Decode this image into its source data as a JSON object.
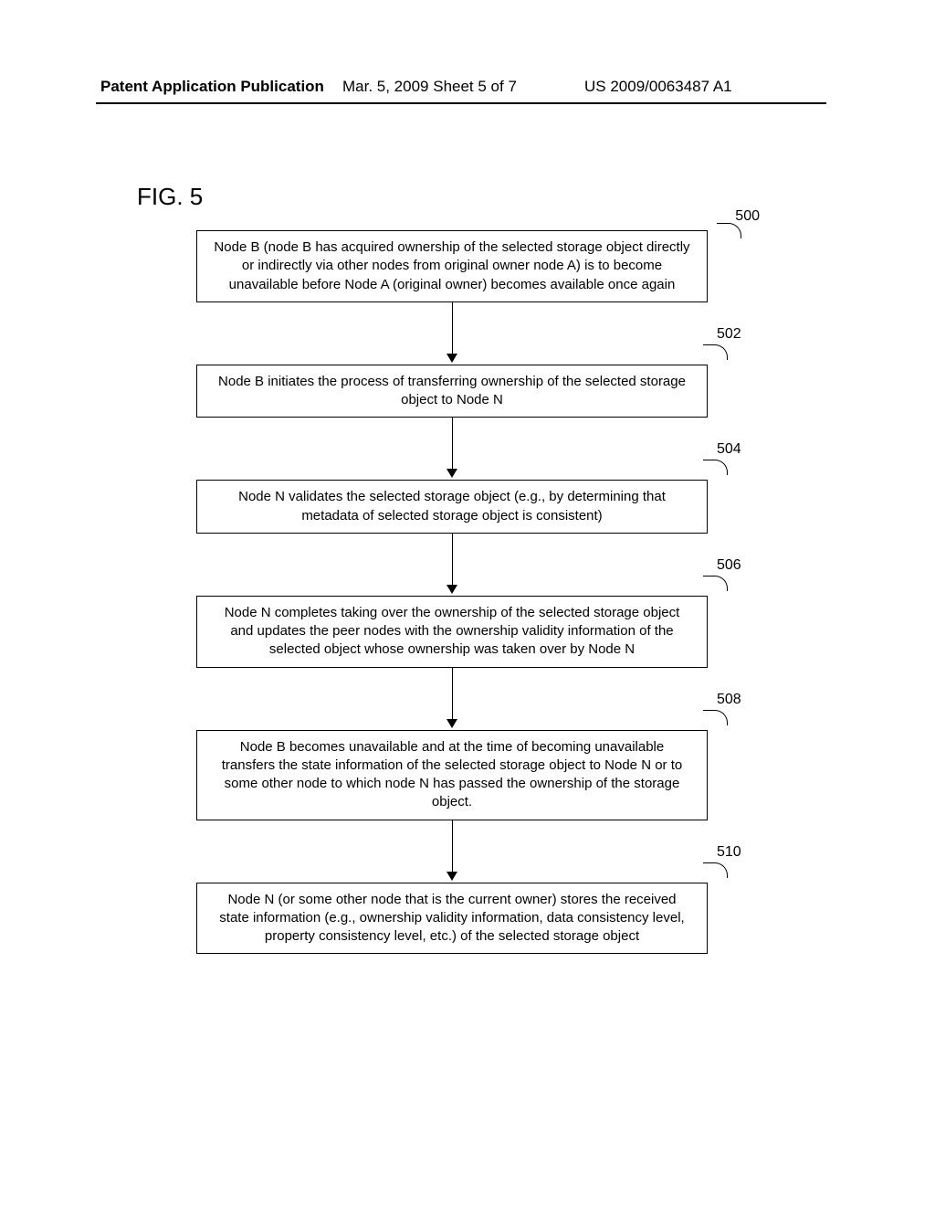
{
  "header": {
    "left": "Patent Application Publication",
    "mid": "Mar. 5, 2009  Sheet 5 of 7",
    "right": "US 2009/0063487 A1"
  },
  "figure_label": "FIG. 5",
  "steps": [
    {
      "ref": "500",
      "text": "Node B (node B has acquired ownership of the selected storage object directly or indirectly via other nodes from original owner node A) is to become unavailable before Node A (original owner) becomes available once again"
    },
    {
      "ref": "502",
      "text": "Node B initiates the process of transferring ownership of the selected storage object to Node N"
    },
    {
      "ref": "504",
      "text": "Node N validates the selected storage object (e.g., by determining that metadata of selected storage object is consistent)"
    },
    {
      "ref": "506",
      "text": "Node N completes taking over the ownership of the selected storage object and updates the peer nodes with the ownership validity information of the selected object whose ownership was taken over by Node N"
    },
    {
      "ref": "508",
      "text": "Node B becomes unavailable and at the time of becoming unavailable transfers  the state information of the selected storage object to Node N or to some other node to which node N has passed the ownership of the storage object."
    },
    {
      "ref": "510",
      "text": "Node N (or some other node that is the current owner) stores the received state information (e.g., ownership validity information, data consistency level, property consistency level, etc.) of the selected storage object"
    }
  ]
}
